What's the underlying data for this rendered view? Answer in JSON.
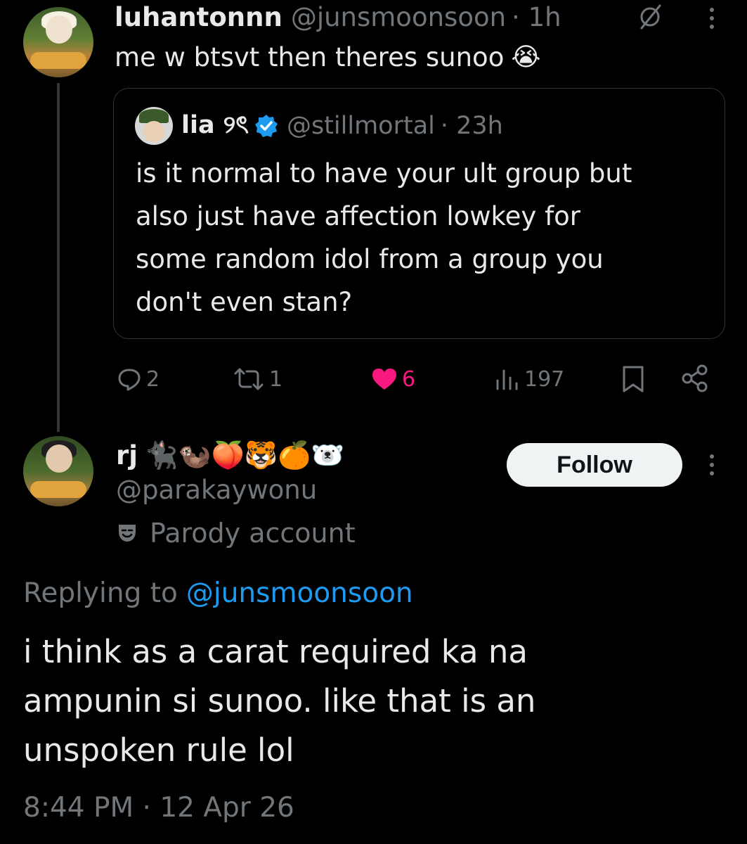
{
  "parent_tweet": {
    "display_name": "luhantonnn",
    "handle": "@junsmoonsoon",
    "time": "· 1h",
    "text": "me w btsvt then theres sunoo",
    "emoji": "😭"
  },
  "quoted_tweet": {
    "display_name": "lia ୨ৎ",
    "handle": "@stillmortal",
    "time": "· 23h",
    "text_lines": [
      "is it normal to have your ult group but",
      "also just have affection lowkey for",
      "some random idol from a group you",
      "don't even stan?"
    ]
  },
  "actions": {
    "replies": "2",
    "reposts": "1",
    "likes": "6",
    "views": "197"
  },
  "reply_tweet": {
    "display_name": "rj",
    "emojis": "🐈‍⬛🦦🍑🐯🍊🐻‍❄️",
    "handle": "@parakaywonu",
    "parody_label": "Parody account",
    "follow_label": "Follow",
    "replying_prefix": "Replying to",
    "replying_handle": "@junsmoonsoon",
    "text_lines": [
      "i think as a carat required ka na",
      "ampunin si sunoo. like that is an",
      "unspoken rule lol"
    ],
    "timestamp": "8:44 PM · 12 Apr 26"
  },
  "colors": {
    "background": "#000000",
    "text": "#e7e9ea",
    "muted": "#71767b",
    "accent_blue": "#1d9bf0",
    "like_pink": "#f91880",
    "border": "#2f3336"
  }
}
